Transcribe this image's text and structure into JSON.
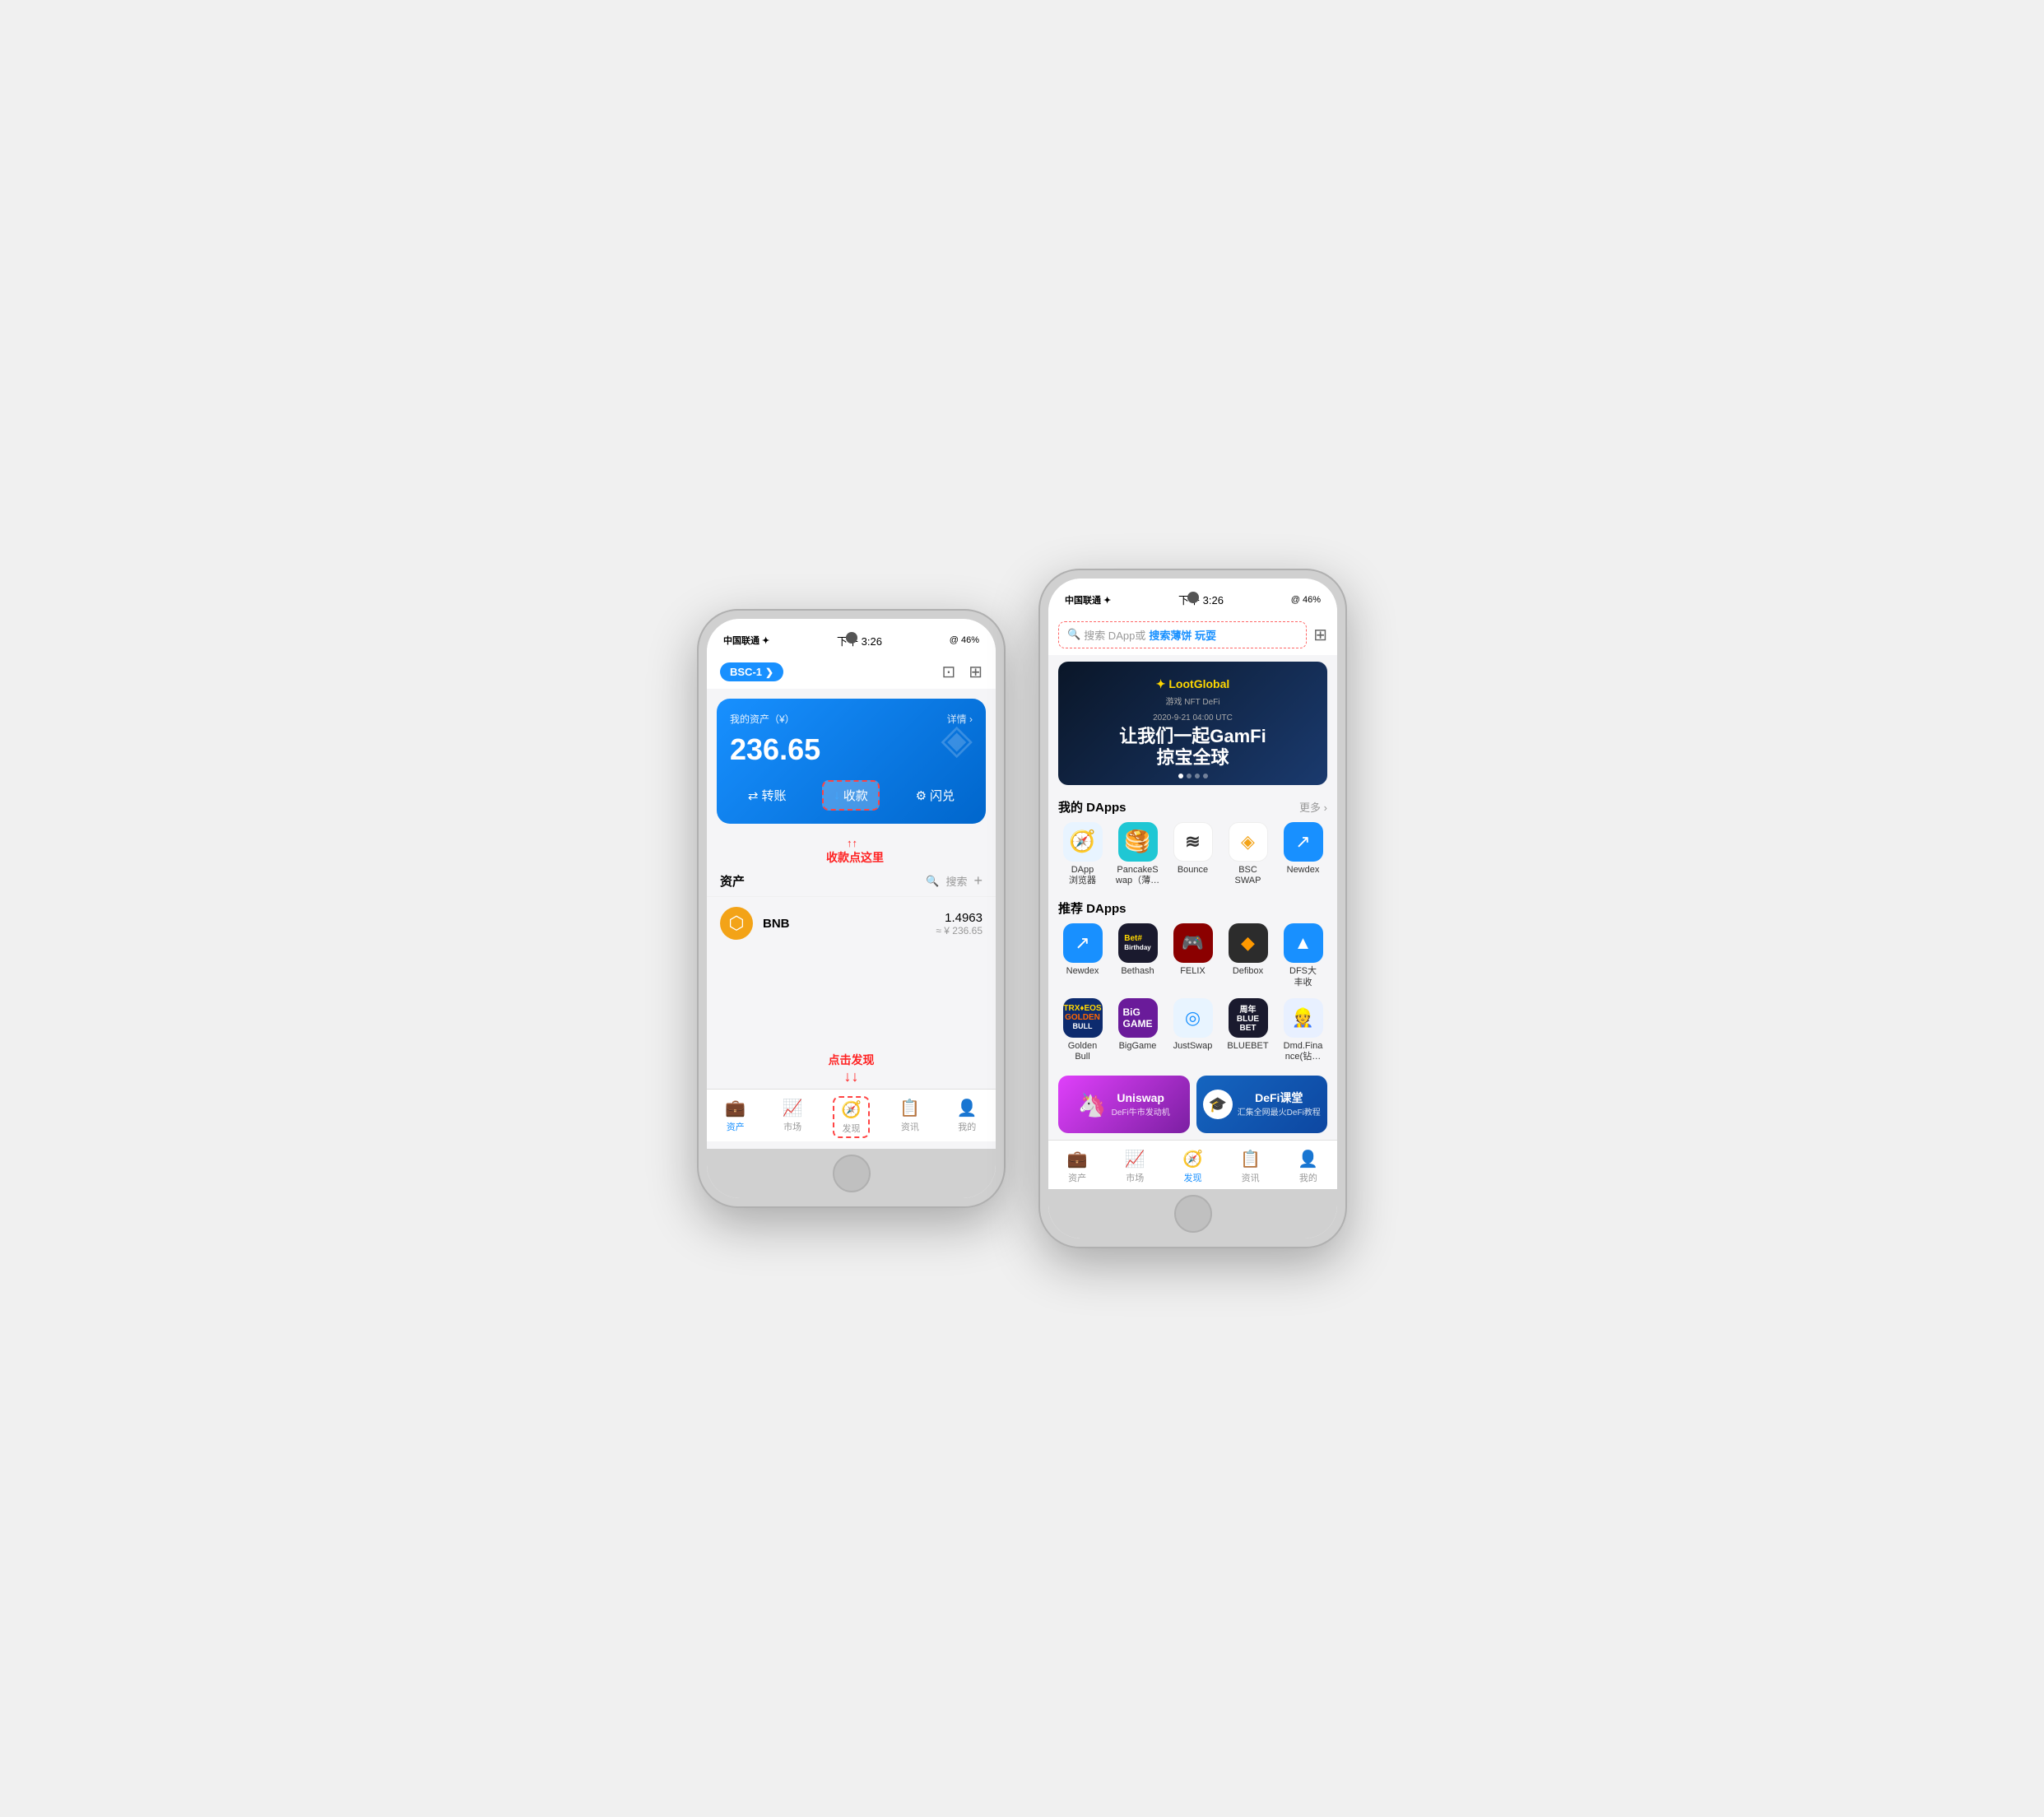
{
  "phone1": {
    "status": {
      "carrier": "中国联通 ✦",
      "time": "下午 3:26",
      "battery": "@ 46%"
    },
    "topbar": {
      "network": "BSC-1",
      "icons": [
        "📷",
        "⊞"
      ]
    },
    "assetCard": {
      "label": "我的资产（¥）",
      "eye_icon": "👁",
      "detail": "详情 ›",
      "amount": "236.65",
      "actions": {
        "transfer": "转账",
        "receive": "收款",
        "exchange": "闪兑"
      }
    },
    "annotation_receive": "收款点这里",
    "assetList": {
      "title": "资产",
      "search": "搜索",
      "add": "+",
      "items": [
        {
          "name": "BNB",
          "amount": "1.4963",
          "fiat": "≈ ¥ 236.65"
        }
      ]
    },
    "bottomNav": [
      {
        "label": "资产",
        "active": true
      },
      {
        "label": "市场",
        "active": false
      },
      {
        "label": "发现",
        "active": false
      },
      {
        "label": "资讯",
        "active": false
      },
      {
        "label": "我的",
        "active": false
      }
    ],
    "annotation_discover": "点击发现"
  },
  "phone2": {
    "status": {
      "carrier": "中国联通 ✦",
      "time": "下午 3:26",
      "battery": "@ 46%"
    },
    "search": {
      "placeholder": "搜索 DApp或",
      "highlight": "搜索薄饼 玩耍"
    },
    "banner": {
      "logo": "✦ LootGlobal",
      "tags": "游戏  NFT  DeFi",
      "date": "2020-9-21  04:00 UTC",
      "main1": "让我们一起GamFi",
      "main2": "掠宝全球"
    },
    "myDapps": {
      "title": "我的 DApps",
      "more": "更多 ›",
      "items": [
        {
          "name": "DApp\n浏览器",
          "icon": "🧭",
          "bg": "#e8f4ff"
        },
        {
          "name": "PancakeS\nwap（薄…",
          "icon": "🥞",
          "bg": "#1fc7d4"
        },
        {
          "name": "Bounce",
          "icon": "≋",
          "bg": "#fff"
        },
        {
          "name": "BSC\nSWAP",
          "icon": "◈",
          "bg": "#fff"
        },
        {
          "name": "Newdex",
          "icon": "↗",
          "bg": "#1890ff"
        }
      ]
    },
    "recommendedDapps": {
      "title": "推荐 DApps",
      "rows": [
        [
          {
            "name": "Newdex",
            "icon": "↗",
            "bg": "#1890ff"
          },
          {
            "name": "Bethash",
            "icon": "Bet#",
            "bg": "#1a1a2e"
          },
          {
            "name": "FELIX",
            "icon": "🎮",
            "bg": "#8b0000"
          },
          {
            "name": "Defibox",
            "icon": "◆",
            "bg": "#2c2c2c"
          },
          {
            "name": "DFS大\n丰收",
            "icon": "▲",
            "bg": "#1890ff"
          }
        ],
        [
          {
            "name": "Golden\nBull",
            "icon": "🐂",
            "bg": "#0d2b6e"
          },
          {
            "name": "BigGame",
            "icon": "BIG",
            "bg": "#6a1b9a"
          },
          {
            "name": "JustSwap",
            "icon": "◎",
            "bg": "#e8f4ff"
          },
          {
            "name": "BLUEBET",
            "icon": "🎮",
            "bg": "#1a1a2e"
          },
          {
            "name": "Dmd.Fina\nnce(钻…",
            "icon": "👷",
            "bg": "#e8f0ff"
          }
        ]
      ]
    },
    "promos": [
      {
        "icon": "🦄",
        "title": "Uniswap",
        "sub": "DeFi牛市发动机",
        "bg1": "#e040fb",
        "bg2": "#7b1fa2"
      },
      {
        "icon": "🎓",
        "title": "DeFi课堂",
        "sub": "汇集全网最火DeFi教程",
        "bg1": "#1565c0",
        "bg2": "#0d47a1"
      }
    ],
    "bottomNav": [
      {
        "label": "资产",
        "active": false
      },
      {
        "label": "市场",
        "active": false
      },
      {
        "label": "发现",
        "active": true
      },
      {
        "label": "资讯",
        "active": false
      },
      {
        "label": "我的",
        "active": false
      }
    ]
  }
}
